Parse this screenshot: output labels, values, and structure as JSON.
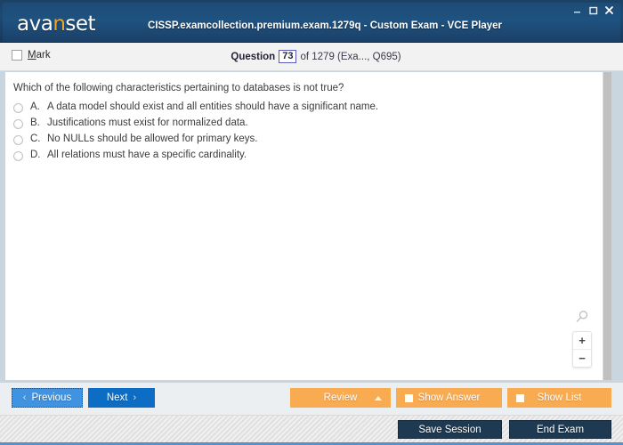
{
  "titlebar": {
    "logo_text": "avanset",
    "logo_accent_char": "n",
    "logo_pre": "ava",
    "logo_post": "set",
    "window_title": "CISSP.examcollection.premium.exam.1279q - Custom Exam - VCE Player",
    "minimize_icon": "minimize-icon",
    "maximize_icon": "maximize-icon",
    "close_icon": "close-icon",
    "bg_color": "#1d4c76"
  },
  "question_header": {
    "mark_label_accel": "M",
    "mark_label_rest": "ark",
    "mark_checked": false,
    "counter_word": "Question",
    "counter_number": "73",
    "counter_suffix": "of 1279 (Exa..., Q695)"
  },
  "question": {
    "text": "Which of the following characteristics pertaining to databases is not true?",
    "answers": [
      {
        "letter": "A.",
        "text": "A data model should exist and all entities should have a significant name.",
        "selected": false
      },
      {
        "letter": "B.",
        "text": "Justifications must exist for normalized data.",
        "selected": false
      },
      {
        "letter": "C.",
        "text": "No NULLs should be allowed for primary keys.",
        "selected": false
      },
      {
        "letter": "D.",
        "text": "All relations must have a specific cardinality.",
        "selected": false
      }
    ]
  },
  "zoom_control": {
    "magnifier_icon": "magnifier-icon",
    "zoom_in_label": "+",
    "zoom_out_label": "−"
  },
  "toolbar": {
    "previous_label": "Previous",
    "previous_chevron": "‹",
    "next_label": "Next",
    "next_chevron": "›",
    "review_label": "Review",
    "show_answer_label": "Show Answer",
    "show_list_label": "Show List",
    "accent_blue": "#0d6cc4",
    "accent_lightblue": "#3f93e0",
    "accent_orange": "#f9ab52"
  },
  "bottombar": {
    "save_session_label": "Save Session",
    "end_exam_label": "End Exam",
    "dark_color": "#1e3a52",
    "underline_color": "#5b8fc9"
  }
}
